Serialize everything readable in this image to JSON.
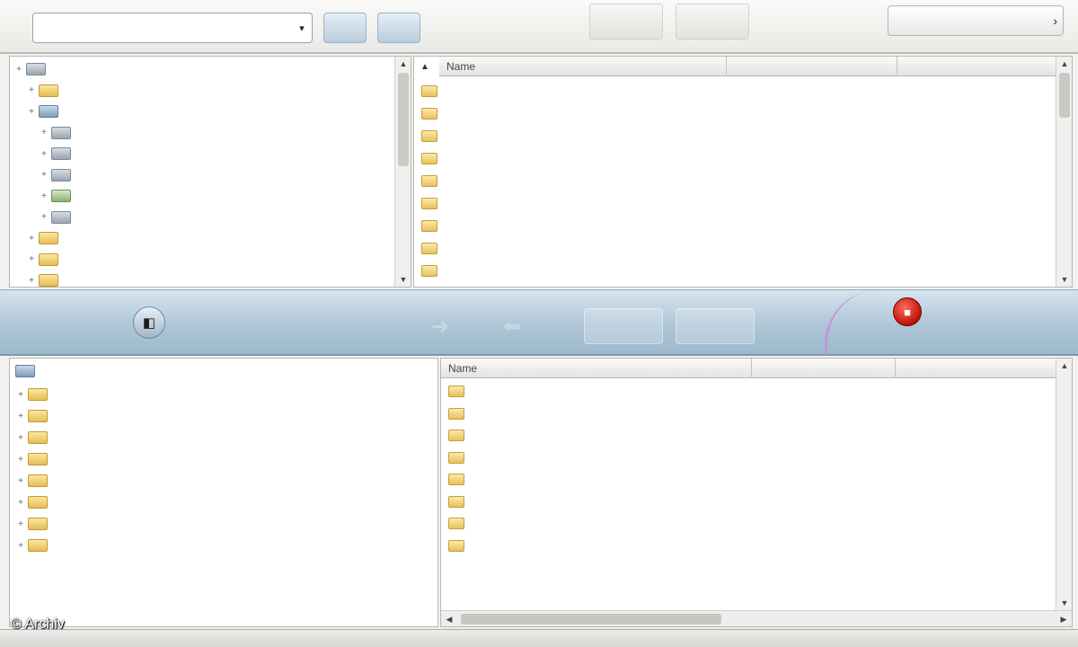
{
  "toolbar": {
    "path_value": "",
    "dropdown_glyph": "▾",
    "btn_a_label": "",
    "btn_b_label": "",
    "top_right_label": "",
    "top_right_icon": "›"
  },
  "local_tree": {
    "items": [
      {
        "label": "",
        "icon": "drive-icon",
        "indent": 0
      },
      {
        "label": "",
        "icon": "folder-icon",
        "indent": 1
      },
      {
        "label": "",
        "icon": "pc-icon",
        "indent": 1
      },
      {
        "label": "",
        "icon": "drive-icon",
        "indent": 2
      },
      {
        "label": "",
        "icon": "drive-icon",
        "indent": 2
      },
      {
        "label": "",
        "icon": "drive-icon",
        "indent": 2
      },
      {
        "label": "",
        "icon": "net-icon",
        "indent": 2
      },
      {
        "label": "",
        "icon": "drive-icon",
        "indent": 2
      },
      {
        "label": "",
        "icon": "folder-icon",
        "indent": 1
      },
      {
        "label": "",
        "icon": "folder-icon",
        "indent": 1
      },
      {
        "label": "",
        "icon": "folder-icon",
        "indent": 1
      }
    ]
  },
  "local_files": {
    "columns": [
      "Name",
      "",
      ""
    ],
    "rows": [
      {
        "name": "",
        "type": "",
        "date": ""
      },
      {
        "name": "",
        "type": "",
        "date": ""
      },
      {
        "name": "",
        "type": "",
        "date": ""
      },
      {
        "name": "",
        "type": "",
        "date": ""
      },
      {
        "name": "",
        "type": "",
        "date": ""
      },
      {
        "name": "",
        "type": "",
        "date": ""
      },
      {
        "name": "",
        "type": "",
        "date": ""
      },
      {
        "name": "",
        "type": "",
        "date": ""
      },
      {
        "name": "",
        "type": "",
        "date": ""
      }
    ]
  },
  "transfer_bar": {
    "connect_label": "",
    "connect_sub": "",
    "square_btn_glyph": "◧",
    "status_text": "",
    "stop_glyph": "■",
    "stop_label": ""
  },
  "remote_tree": {
    "root_label": "",
    "items": [
      {
        "label": ""
      },
      {
        "label": ""
      },
      {
        "label": ""
      },
      {
        "label": ""
      },
      {
        "label": ""
      },
      {
        "label": ""
      },
      {
        "label": ""
      },
      {
        "label": ""
      }
    ]
  },
  "remote_files": {
    "columns": [
      "Name",
      "",
      ""
    ],
    "rows": [
      {
        "name": "",
        "type": ""
      },
      {
        "name": "",
        "type": ""
      },
      {
        "name": "",
        "type": ""
      },
      {
        "name": "",
        "type": ""
      },
      {
        "name": "",
        "type": ""
      },
      {
        "name": "",
        "type": ""
      },
      {
        "name": "",
        "type": ""
      },
      {
        "name": "",
        "type": ""
      }
    ]
  },
  "statusbar": {
    "main_text": "",
    "right_text": ""
  },
  "watermark": "© Archiv",
  "colors": {
    "transfer_bar": "#aec6d6",
    "stop_red": "#c3190d",
    "folder_yellow": "#e9c15b"
  }
}
